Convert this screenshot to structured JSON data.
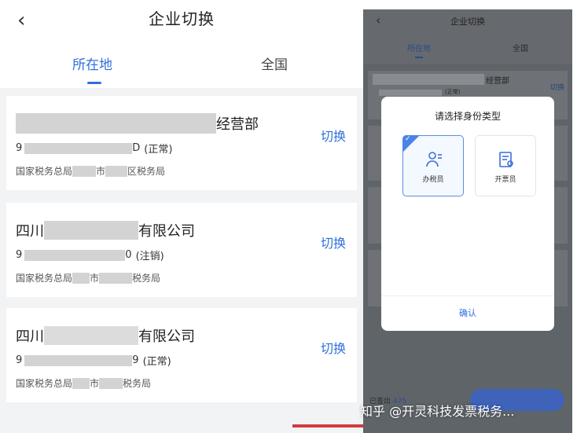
{
  "left": {
    "title": "企业切换",
    "back_icon": "chevron-left-icon",
    "tabs": [
      {
        "label": "所在地",
        "active": true
      },
      {
        "label": "全国",
        "active": false
      }
    ],
    "companies": [
      {
        "name_suffix": "经营部",
        "code_prefix": "9",
        "code_suffix": "D",
        "status": "(正常)",
        "dept_1": "国家税务总局",
        "dept_2": "市",
        "dept_3": "区税务局",
        "action": "切换"
      },
      {
        "name_prefix": "四川",
        "name_suffix": "有限公司",
        "code_prefix": "9",
        "code_suffix": "0",
        "status": "(注销)",
        "dept_1": "国家税务总局",
        "dept_2": "市",
        "dept_3": "税务局",
        "action": "切换"
      },
      {
        "name_prefix": "四川",
        "name_suffix": "有限公司",
        "code_prefix": "9",
        "code_suffix": "9",
        "status": "(正常)",
        "dept_1": "国家税务总局",
        "dept_2": "市",
        "dept_3": "税务局",
        "action": "切换"
      }
    ]
  },
  "right": {
    "title": "企业切换",
    "tabs": [
      "所在地",
      "全国"
    ],
    "card1_suffix": "经营部",
    "card1_status": "(正常)",
    "card_action": "切换",
    "dialog": {
      "title": "请选择身份类型",
      "options": [
        {
          "label": "办税员",
          "icon": "tax-officer-icon",
          "selected": true
        },
        {
          "label": "开票员",
          "icon": "invoice-clerk-icon",
          "selected": false
        }
      ],
      "confirm": "确认"
    },
    "bottom_text": "已查出",
    "bottom_count": "475"
  },
  "watermark": "知乎 @开灵科技发票税务..."
}
